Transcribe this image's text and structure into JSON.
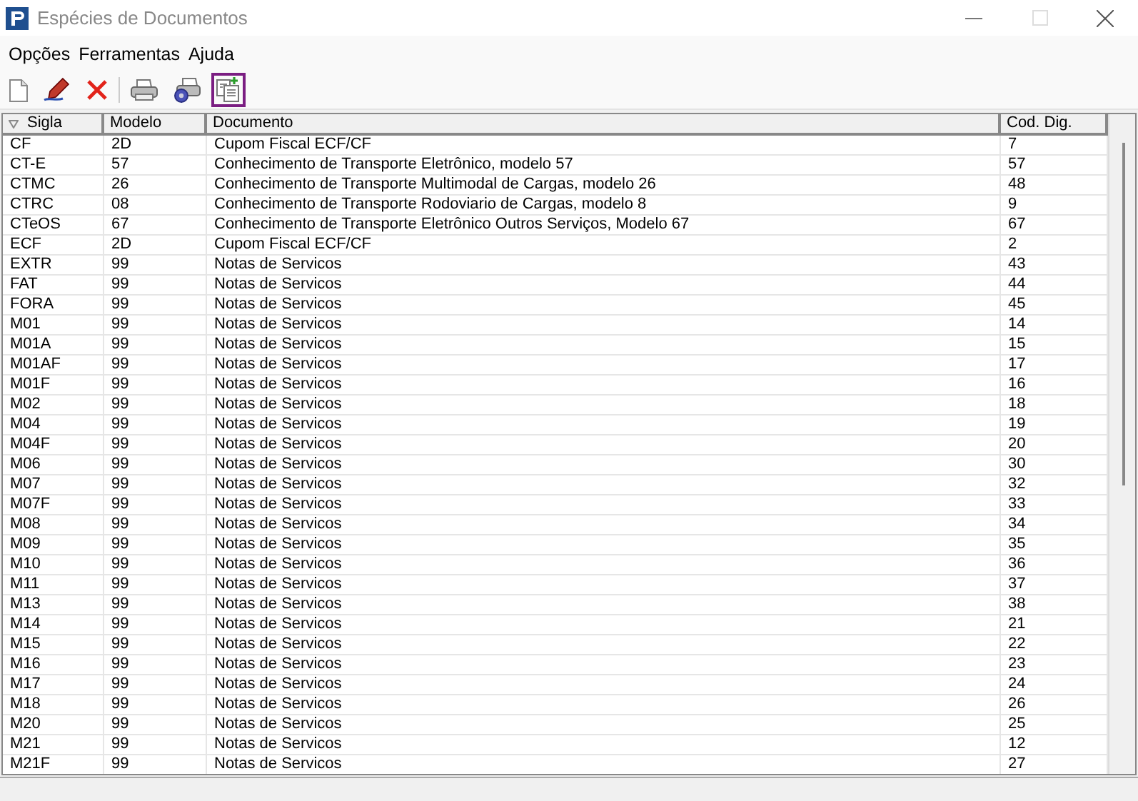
{
  "window": {
    "title": "Espécies de Documentos",
    "maximize_disabled": true
  },
  "menu": [
    "Opções",
    "Ferramentas",
    "Ajuda"
  ],
  "toolbar": [
    {
      "kind": "new",
      "highlighted": false
    },
    {
      "kind": "edit",
      "highlighted": false
    },
    {
      "kind": "delete",
      "highlighted": false
    },
    {
      "kind": "separator"
    },
    {
      "kind": "print",
      "highlighted": false
    },
    {
      "kind": "print-setup",
      "highlighted": false
    },
    {
      "kind": "copy",
      "highlighted": true
    }
  ],
  "table": {
    "columns": [
      {
        "label": "Sigla",
        "sorted": true
      },
      {
        "label": "Modelo",
        "sorted": false
      },
      {
        "label": "Documento",
        "sorted": false
      },
      {
        "label": "Cod. Dig.",
        "sorted": false
      }
    ],
    "rows": [
      [
        "CF",
        "2D",
        "Cupom Fiscal ECF/CF",
        "7"
      ],
      [
        "CT-E",
        "57",
        "Conhecimento de Transporte Eletrônico, modelo 57",
        "57"
      ],
      [
        "CTMC",
        "26",
        "Conhecimento de Transporte Multimodal de Cargas, modelo 26",
        "48"
      ],
      [
        "CTRC",
        "08",
        "Conhecimento de Transporte Rodoviario de Cargas, modelo 8",
        "9"
      ],
      [
        "CTeOS",
        "67",
        "Conhecimento de Transporte Eletrônico Outros Serviços, Modelo 67",
        "67"
      ],
      [
        "ECF",
        "2D",
        "Cupom Fiscal ECF/CF",
        "2"
      ],
      [
        "EXTR",
        "99",
        "Notas de Servicos",
        "43"
      ],
      [
        "FAT",
        "99",
        "Notas de Servicos",
        "44"
      ],
      [
        "FORA",
        "99",
        "Notas de Servicos",
        "45"
      ],
      [
        "M01",
        "99",
        "Notas de Servicos",
        "14"
      ],
      [
        "M01A",
        "99",
        "Notas de Servicos",
        "15"
      ],
      [
        "M01AF",
        "99",
        "Notas de Servicos",
        "17"
      ],
      [
        "M01F",
        "99",
        "Notas de Servicos",
        "16"
      ],
      [
        "M02",
        "99",
        "Notas de Servicos",
        "18"
      ],
      [
        "M04",
        "99",
        "Notas de Servicos",
        "19"
      ],
      [
        "M04F",
        "99",
        "Notas de Servicos",
        "20"
      ],
      [
        "M06",
        "99",
        "Notas de Servicos",
        "30"
      ],
      [
        "M07",
        "99",
        "Notas de Servicos",
        "32"
      ],
      [
        "M07F",
        "99",
        "Notas de Servicos",
        "33"
      ],
      [
        "M08",
        "99",
        "Notas de Servicos",
        "34"
      ],
      [
        "M09",
        "99",
        "Notas de Servicos",
        "35"
      ],
      [
        "M10",
        "99",
        "Notas de Servicos",
        "36"
      ],
      [
        "M11",
        "99",
        "Notas de Servicos",
        "37"
      ],
      [
        "M13",
        "99",
        "Notas de Servicos",
        "38"
      ],
      [
        "M14",
        "99",
        "Notas de Servicos",
        "21"
      ],
      [
        "M15",
        "99",
        "Notas de Servicos",
        "22"
      ],
      [
        "M16",
        "99",
        "Notas de Servicos",
        "23"
      ],
      [
        "M17",
        "99",
        "Notas de Servicos",
        "24"
      ],
      [
        "M18",
        "99",
        "Notas de Servicos",
        "26"
      ],
      [
        "M20",
        "99",
        "Notas de Servicos",
        "25"
      ],
      [
        "M21",
        "99",
        "Notas de Servicos",
        "12"
      ],
      [
        "M21F",
        "99",
        "Notas de Servicos",
        "27"
      ]
    ]
  }
}
